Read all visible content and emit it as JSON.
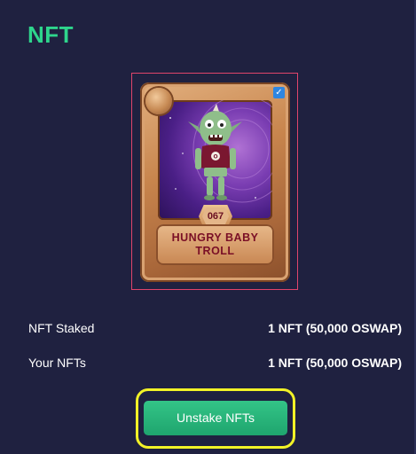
{
  "section": {
    "title": "NFT"
  },
  "nft_card": {
    "number": "067",
    "name_line1": "HUNGRY BABY",
    "name_line2": "TROLL",
    "selected": true,
    "icons": {
      "check": "checkmark-icon",
      "corner": "coin-icon"
    },
    "colors": {
      "frame_highlight": "#e0446b",
      "card_bronze": "#c8854d",
      "art_background": "#7a3db2",
      "name_text": "#7a0f26"
    }
  },
  "info_rows": [
    {
      "label": "NFT Staked",
      "value": "1 NFT (50,000 OSWAP)"
    },
    {
      "label": "Your NFTs",
      "value": "1 NFT (50,000 OSWAP)"
    }
  ],
  "actions": {
    "unstake_label": "Unstake NFTs"
  },
  "theme": {
    "background": "#1f2140",
    "accent": "#2ed58c",
    "button": "#1fa56e",
    "focus_outline": "#f2f227"
  }
}
